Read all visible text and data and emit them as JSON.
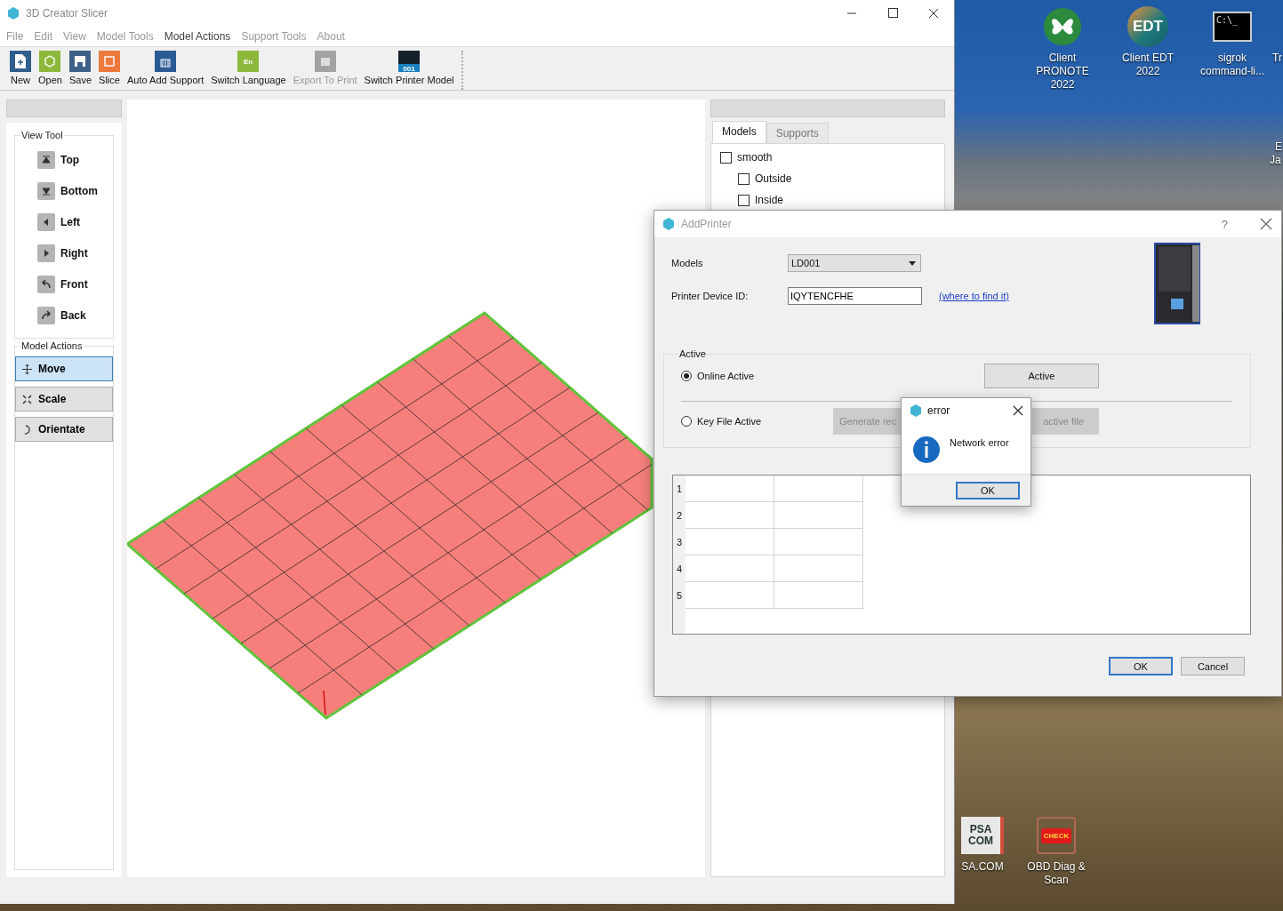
{
  "main_window": {
    "title": "3D Creator Slicer"
  },
  "menu": [
    {
      "label": "File",
      "selected": false
    },
    {
      "label": "Edit",
      "selected": false
    },
    {
      "label": "View",
      "selected": false
    },
    {
      "label": "Model Tools",
      "selected": false
    },
    {
      "label": "Model Actions",
      "selected": true
    },
    {
      "label": "Support Tools",
      "selected": false
    },
    {
      "label": "About",
      "selected": false
    }
  ],
  "toolbar": [
    {
      "label": "New",
      "kind": "new",
      "disabled": false
    },
    {
      "label": "Open",
      "kind": "open",
      "disabled": false
    },
    {
      "label": "Save",
      "kind": "save",
      "disabled": false
    },
    {
      "label": "Slice",
      "kind": "slice",
      "disabled": false
    },
    {
      "label": "Auto Add Support",
      "kind": "support",
      "disabled": false
    },
    {
      "label": "Switch Language",
      "kind": "language",
      "disabled": false,
      "icon_text": "En"
    },
    {
      "label": "Export To Print",
      "kind": "export",
      "disabled": true
    },
    {
      "label": "Switch Printer Model",
      "kind": "printer",
      "disabled": false,
      "icon_text": "001"
    }
  ],
  "view_tool": {
    "title": "View Tool",
    "buttons": [
      {
        "label": "Top",
        "kind": "top"
      },
      {
        "label": "Bottom",
        "kind": "bottom"
      },
      {
        "label": "Left",
        "kind": "left"
      },
      {
        "label": "Right",
        "kind": "right"
      },
      {
        "label": "Front",
        "kind": "front"
      },
      {
        "label": "Back",
        "kind": "back"
      }
    ]
  },
  "model_actions": {
    "title": "Model Actions",
    "buttons": [
      {
        "label": "Move",
        "kind": "move",
        "selected": true
      },
      {
        "label": "Scale",
        "kind": "scale",
        "selected": false
      },
      {
        "label": "Orientate",
        "kind": "orientate",
        "selected": false
      }
    ]
  },
  "model_panel": {
    "tabs": [
      {
        "label": "Models",
        "selected": true
      },
      {
        "label": "Supports",
        "selected": false
      }
    ],
    "tree": [
      {
        "label": "smooth",
        "checked": false,
        "children": [
          {
            "label": "Outside",
            "checked": false
          },
          {
            "label": "Inside",
            "checked": false
          }
        ]
      }
    ]
  },
  "add_printer": {
    "title": "AddPrinter",
    "help": "?",
    "models_label": "Models",
    "model_value": "LD001",
    "device_id_label": "Printer Device ID:",
    "device_id_value": "IQYTENCFHE",
    "link": "(where to find it)",
    "group_title": "Active",
    "options": [
      {
        "label": "Online Active",
        "selected": true
      },
      {
        "label": "Key File Active",
        "selected": false
      }
    ],
    "active_button": "Active",
    "key_buttons": [
      "Generate rec",
      "active file"
    ],
    "row_headers": [
      "1",
      "2",
      "3",
      "4",
      "5"
    ],
    "ok": "OK",
    "cancel": "Cancel"
  },
  "error_dialog": {
    "title": "error",
    "message": "Network error",
    "ok": "OK"
  },
  "desktop": {
    "icons": [
      {
        "label": "Client PRONOTE 2022",
        "kind": "pronote"
      },
      {
        "label": "Client EDT 2022",
        "kind": "edt",
        "icon_text": "EDT"
      },
      {
        "label": "sigrok command-li...",
        "kind": "terminal",
        "icon_text": "C:\\_"
      },
      {
        "label": "SA.COM",
        "kind": "psa",
        "icon_text": "PSA COM"
      },
      {
        "label": "OBD Diag & Scan",
        "kind": "check",
        "icon_text": "CHECK"
      }
    ],
    "edge_labels": [
      "Tr",
      "E",
      "Ja"
    ]
  }
}
